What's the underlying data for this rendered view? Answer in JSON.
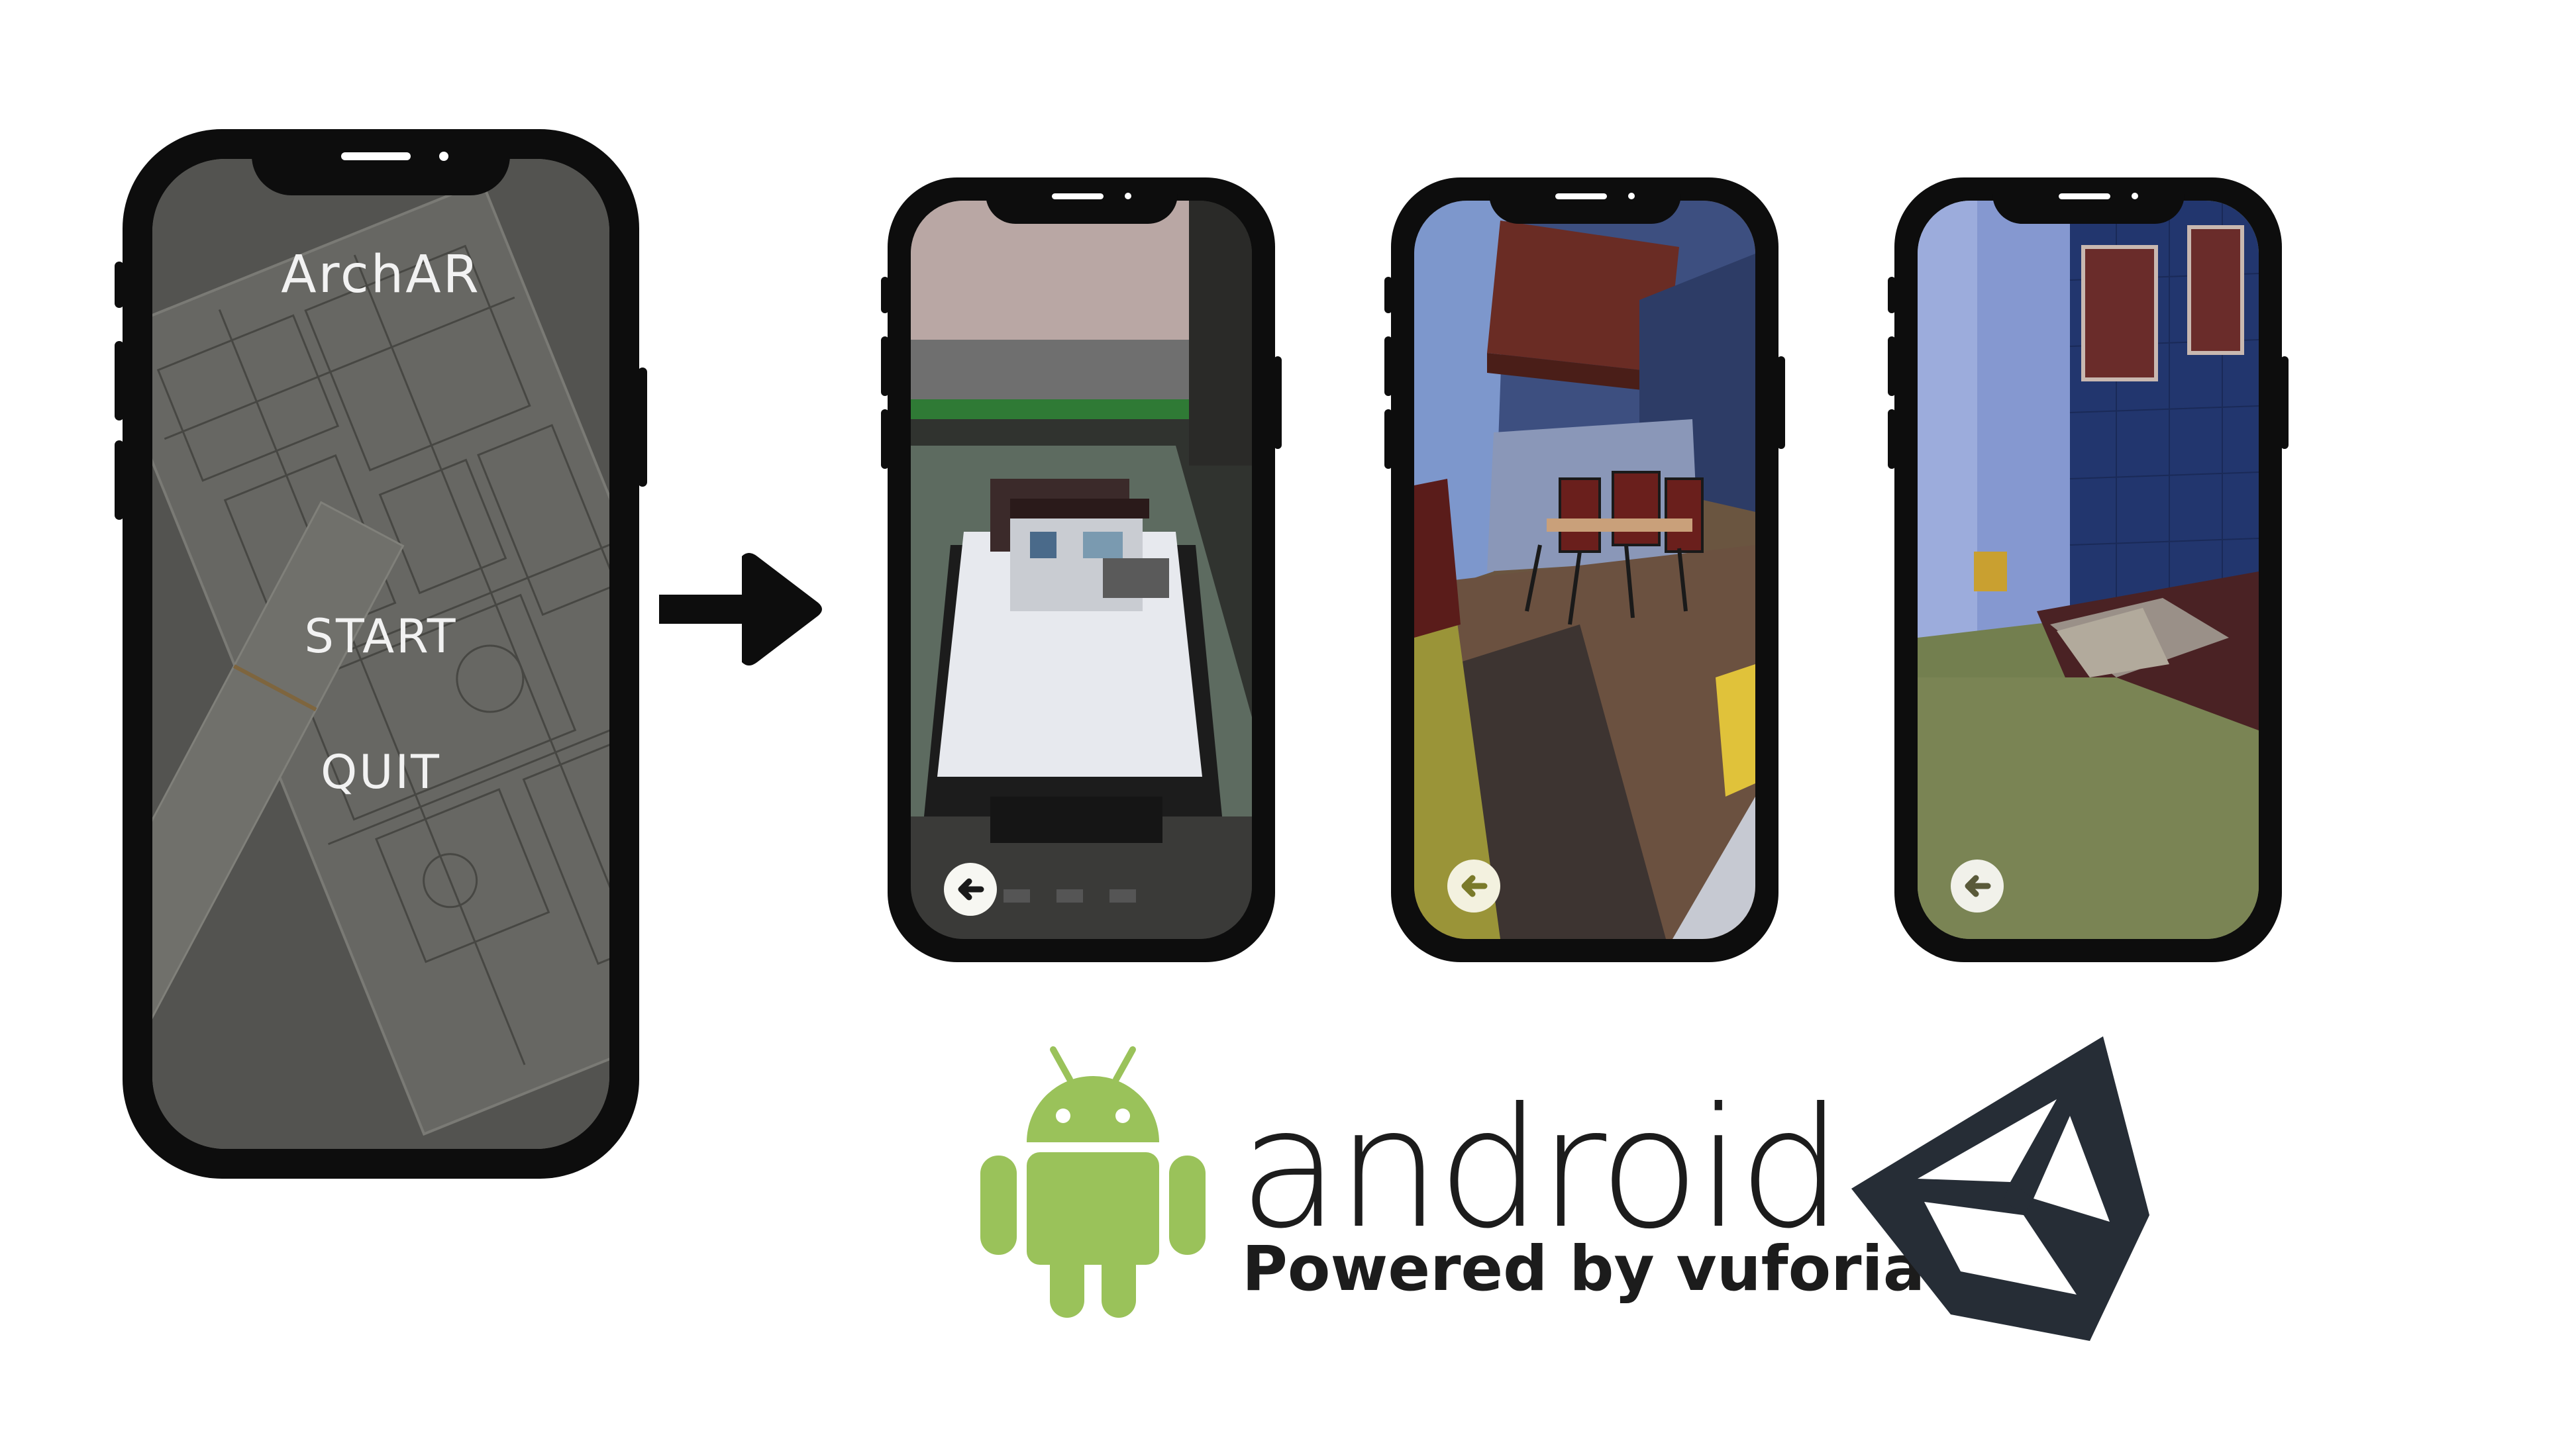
{
  "menu_phone": {
    "title": "ArchAR",
    "start_label": "START",
    "quit_label": "QUIT"
  },
  "ar_screens": [
    {
      "screen": "ar-model-view",
      "back_icon": "back-arrow-icon"
    },
    {
      "screen": "ar-dining-room-view",
      "back_icon": "back-arrow-icon"
    },
    {
      "screen": "ar-bedroom-view",
      "back_icon": "back-arrow-icon"
    }
  ],
  "flow_icon": "right-arrow-icon",
  "logos": {
    "android_word": "android",
    "powered_by": "Powered by vuforia",
    "android_logo": "android-robot-icon",
    "unity_logo": "unity-logo-icon"
  },
  "colors": {
    "phone_frame": "#0d0d0d",
    "android_green": "#9ac25a",
    "unity_dark": "#262d36",
    "menu_overlay": "#5a5a56"
  }
}
